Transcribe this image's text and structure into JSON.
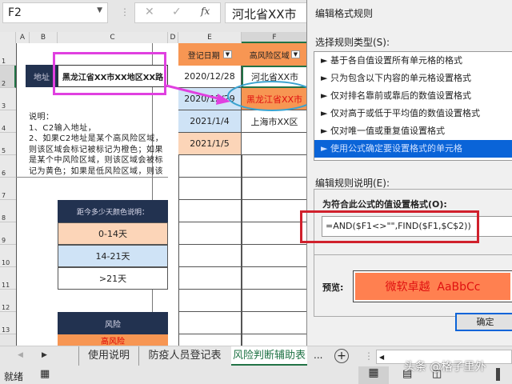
{
  "formula_bar": {
    "name_box": "F2",
    "cancel": "✕",
    "enter": "✓",
    "fx": "fx",
    "content": "河北省XX市"
  },
  "columns": [
    "A",
    "B",
    "C",
    "D",
    "E",
    "F"
  ],
  "rows": [
    "1",
    "2",
    "3",
    "4",
    "5",
    "6",
    "7",
    "8",
    "9",
    "10",
    "11",
    "12",
    "13"
  ],
  "left": {
    "address_label": "地址",
    "address_value": "黑龙江省XX市XX地区XX路",
    "note": "说明：\n1、C2输入地址，\n2、如果C2地址是某个高风险区域，则该区域会标记被标记为橙色；如果是某个中风险区域，则该区域会被标记为黄色；如果是低风险区域，则该区域会被标记",
    "days_header": "距今多少天颜色说明：",
    "days": [
      "0-14天",
      "14-21天",
      ">21天"
    ],
    "risk_header": "风险",
    "risk_first": "高风险"
  },
  "table": {
    "headers": [
      "登记日期",
      "高风险区域"
    ],
    "rows": [
      [
        "2020/12/28",
        "河北省XX市"
      ],
      [
        "2020/12/29",
        "黑龙江省XX市"
      ],
      [
        "2021/1/4",
        "上海市XX区"
      ],
      [
        "2021/1/5",
        ""
      ]
    ]
  },
  "dialog": {
    "title": "编辑格式规则",
    "select_label": "选择规则类型(S):",
    "rules": [
      "基于各自值设置所有单元格的格式",
      "只为包含以下内容的单元格设置格式",
      "仅对排名靠前或靠后的数值设置格式",
      "仅对高于或低于平均值的数值设置格式",
      "仅对唯一值或重复值设置格式",
      "使用公式确定要设置格式的单元格"
    ],
    "selected_rule": 5,
    "edit_label": "编辑规则说明(E):",
    "formula_label": "为符合此公式的值设置格式(O):",
    "formula": "=AND($F1<>\"\",FIND($F1,$C$2))",
    "preview_label": "预览:",
    "preview_text": "微软卓越  AaBbCc",
    "ok": "确定"
  },
  "colors": {
    "orange": "#f79653",
    "light_orange": "#fcd5b8",
    "light_blue": "#cfe3f6",
    "navy": "#223250",
    "highlight_pink": "#e040e0",
    "highlight_red": "#d0202c",
    "selection_blue": "#0a64d8"
  },
  "sheet_tabs": [
    "使用说明",
    "防疫人员登记表",
    "风险判断辅助表"
  ],
  "active_tab": 2,
  "more_tabs": "...",
  "add_sheet": "+",
  "status": {
    "ready": "就绪"
  },
  "watermark": "头条 @格子里外"
}
